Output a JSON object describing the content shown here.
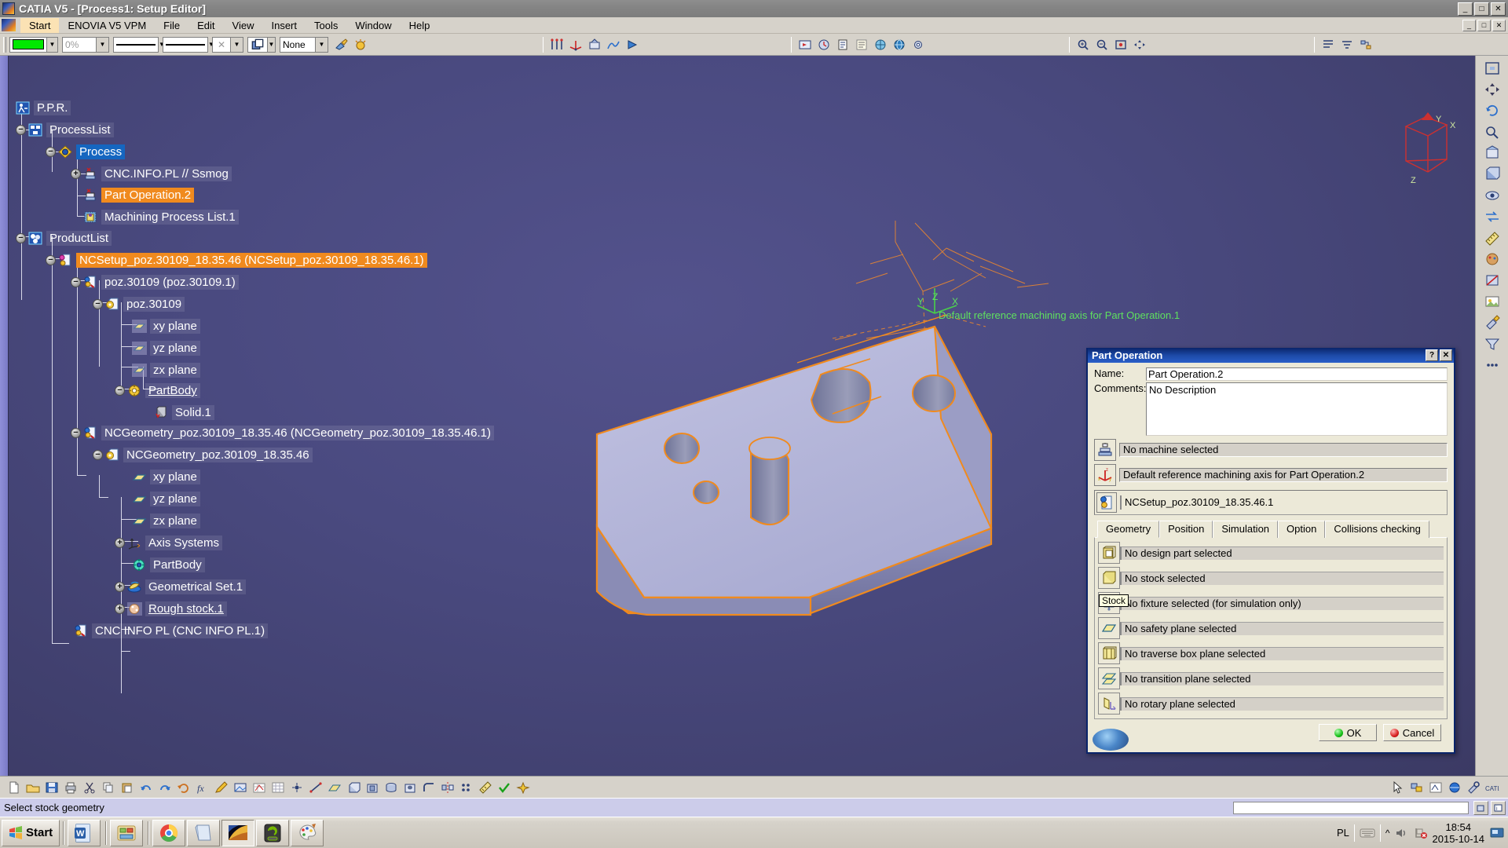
{
  "window": {
    "title": "CATIA V5 - [Process1: Setup Editor]",
    "min_label": "_",
    "max_label": "□",
    "close_label": "✕"
  },
  "menubar": {
    "items": [
      {
        "label": "Start"
      },
      {
        "label": "ENOVIA V5 VPM"
      },
      {
        "label": "File"
      },
      {
        "label": "Edit"
      },
      {
        "label": "View"
      },
      {
        "label": "Insert"
      },
      {
        "label": "Tools"
      },
      {
        "label": "Window"
      },
      {
        "label": "Help"
      }
    ],
    "doc_min": "_",
    "doc_max": "□",
    "doc_close": "✕"
  },
  "toolbar": {
    "color_swatch": "#00e800",
    "transparency": "0%",
    "line_weight": "",
    "line_type": "",
    "render_style": "",
    "layer": "None"
  },
  "tree": {
    "nodes": [
      {
        "label": "P.P.R.",
        "icon": "ppr-icon",
        "state": "none",
        "depth": 0,
        "style": "plain"
      },
      {
        "label": "ProcessList",
        "icon": "process-list-icon",
        "state": "minus",
        "depth": 1,
        "style": "plain"
      },
      {
        "label": "Process",
        "icon": "process-icon",
        "state": "minus",
        "depth": 2,
        "style": "sel-blue"
      },
      {
        "label": "CNC.INFO.PL  // Ssmog",
        "icon": "part-operation-icon",
        "state": "plus",
        "depth": 3,
        "style": "plain"
      },
      {
        "label": "Part Operation.2",
        "icon": "part-operation-icon",
        "state": "none",
        "depth": 3,
        "style": "sel-orange"
      },
      {
        "label": "Machining Process List.1",
        "icon": "machining-process-icon",
        "state": "none",
        "depth": 3,
        "style": "plain"
      },
      {
        "label": "ProductList",
        "icon": "product-list-icon",
        "state": "minus",
        "depth": 1,
        "style": "plain"
      },
      {
        "label": "NCSetup_poz.30109_18.35.46 (NCSetup_poz.30109_18.35.46.1)",
        "icon": "ncsetup-icon",
        "state": "minus",
        "depth": 2,
        "style": "sel-orange"
      },
      {
        "label": "poz.30109 (poz.30109.1)",
        "icon": "product-icon",
        "state": "minus",
        "depth": 3,
        "style": "plain"
      },
      {
        "label": "poz.30109",
        "icon": "part-icon",
        "state": "minus",
        "depth": 4,
        "style": "plain"
      },
      {
        "label": "xy plane",
        "icon": "plane-hatched-icon",
        "state": "none",
        "depth": 5,
        "style": "plain"
      },
      {
        "label": "yz plane",
        "icon": "plane-hatched-icon",
        "state": "none",
        "depth": 5,
        "style": "plain"
      },
      {
        "label": "zx plane",
        "icon": "plane-hatched-icon",
        "state": "none",
        "depth": 5,
        "style": "plain"
      },
      {
        "label": "PartBody",
        "icon": "partbody-yellow-icon",
        "state": "minus",
        "depth": 5,
        "style": "underline"
      },
      {
        "label": "Solid.1",
        "icon": "solid-icon",
        "state": "none",
        "depth": 6,
        "style": "plain"
      },
      {
        "label": "NCGeometry_poz.30109_18.35.46 (NCGeometry_poz.30109_18.35.46.1)",
        "icon": "product-icon",
        "state": "minus",
        "depth": 3,
        "style": "plain"
      },
      {
        "label": "NCGeometry_poz.30109_18.35.46",
        "icon": "part-icon",
        "state": "minus",
        "depth": 4,
        "style": "plain"
      },
      {
        "label": "xy plane",
        "icon": "plane-icon",
        "state": "none",
        "depth": 5,
        "style": "plain"
      },
      {
        "label": "yz plane",
        "icon": "plane-icon",
        "state": "none",
        "depth": 5,
        "style": "plain"
      },
      {
        "label": "zx plane",
        "icon": "plane-icon",
        "state": "none",
        "depth": 5,
        "style": "plain"
      },
      {
        "label": "Axis Systems",
        "icon": "axis-system-icon",
        "state": "plus",
        "depth": 5,
        "style": "plain"
      },
      {
        "label": "PartBody",
        "icon": "partbody-green-icon",
        "state": "none",
        "depth": 5,
        "style": "plain"
      },
      {
        "label": "Geometrical Set.1",
        "icon": "geometrical-set-icon",
        "state": "plus",
        "depth": 5,
        "style": "plain"
      },
      {
        "label": "Rough stock.1",
        "icon": "rough-stock-icon",
        "state": "plus",
        "depth": 5,
        "style": "underline"
      },
      {
        "label": "CNC INFO PL (CNC INFO PL.1)",
        "icon": "product-icon",
        "state": "none",
        "depth": 2,
        "style": "plain"
      }
    ]
  },
  "viewport": {
    "axis_annotation": "Default reference machining axis for Part Operation.1",
    "compass_labels": {
      "x": "X",
      "y": "Y",
      "z": "Z"
    },
    "origin_labels": {
      "z": "Z",
      "x": "X",
      "y": "Y"
    }
  },
  "dialog": {
    "title": "Part Operation",
    "help_btn": "?",
    "close_btn": "✕",
    "name_label": "Name:",
    "name_value": "Part Operation.2",
    "comments_label": "Comments:",
    "comments_value": "No Description",
    "machine_value": "No machine selected",
    "machine_icon": "machine-icon",
    "axis_value": "Default reference machining axis for Part Operation.2",
    "axis_icon": "machining-axis-icon",
    "setup_value": "NCSetup_poz.30109_18.35.46.1",
    "setup_icon": "ncsetup-icon",
    "tabs": [
      {
        "label": "Geometry",
        "active": true
      },
      {
        "label": "Position",
        "active": false
      },
      {
        "label": "Simulation",
        "active": false
      },
      {
        "label": "Option",
        "active": false
      },
      {
        "label": "Collisions checking",
        "active": false
      }
    ],
    "geometry_rows": [
      {
        "icon": "design-part-icon",
        "value": "No design part selected"
      },
      {
        "icon": "stock-icon",
        "value": "No stock selected"
      },
      {
        "icon": "fixture-icon",
        "value": "No fixture selected (for simulation only)",
        "icon_text": "Stock"
      },
      {
        "icon": "safety-plane-icon",
        "value": "No safety plane selected"
      },
      {
        "icon": "traverse-box-icon",
        "value": "No traverse box plane selected"
      },
      {
        "icon": "transition-plane-icon",
        "value": "No transition plane selected"
      },
      {
        "icon": "rotary-plane-icon",
        "value": "No rotary plane selected"
      }
    ],
    "ok_label": "OK",
    "cancel_label": "Cancel"
  },
  "statusbar": {
    "message": "Select stock geometry",
    "input_value": ""
  },
  "taskbar": {
    "start_label": "Start",
    "items": [
      {
        "name": "word",
        "pressed": false
      },
      {
        "name": "explorer",
        "pressed": false
      },
      {
        "name": "chrome",
        "pressed": false
      },
      {
        "name": "notepad",
        "pressed": false
      },
      {
        "name": "catia",
        "pressed": true
      },
      {
        "name": "nvidia",
        "pressed": false
      },
      {
        "name": "paint",
        "pressed": false
      }
    ],
    "language": "PL",
    "time": "18:54",
    "date": "2015-10-14"
  }
}
